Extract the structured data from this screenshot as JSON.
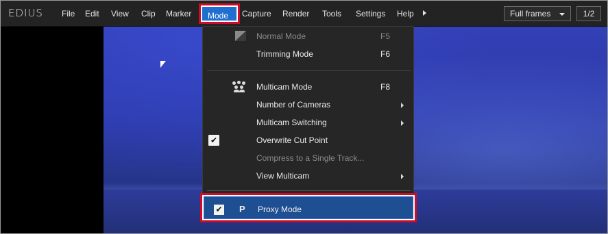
{
  "app": {
    "logo": "EDIUS"
  },
  "menubar": {
    "items": [
      "File",
      "Edit",
      "View",
      "Clip",
      "Marker",
      "Mode",
      "Capture",
      "Render",
      "Tools",
      "Settings",
      "Help"
    ],
    "active": "Mode"
  },
  "toolbar": {
    "view_select": "Full frames",
    "page_indicator": "1/2"
  },
  "mode_menu": {
    "items": [
      {
        "label": "Normal Mode",
        "shortcut": "F5",
        "enabled": false,
        "icon": "normal-mode-icon"
      },
      {
        "label": "Trimming Mode",
        "shortcut": "F6",
        "enabled": true
      },
      {
        "label": "Multicam Mode",
        "shortcut": "F8",
        "enabled": true,
        "icon": "multicam-icon"
      },
      {
        "label": "Number of Cameras",
        "enabled": true,
        "submenu": true
      },
      {
        "label": "Multicam Switching",
        "enabled": true,
        "submenu": true
      },
      {
        "label": "Overwrite Cut Point",
        "enabled": true,
        "checked": true
      },
      {
        "label": "Compress to a Single Track...",
        "enabled": false
      },
      {
        "label": "View Multicam",
        "enabled": true,
        "submenu": true
      },
      {
        "label": "Proxy Mode",
        "enabled": true,
        "checked": true,
        "icon_text": "P",
        "highlighted": true
      }
    ]
  },
  "colors": {
    "highlight_outline": "#cf0c27",
    "selection_blue": "#1f6fd0",
    "menu_bg": "#262626"
  }
}
